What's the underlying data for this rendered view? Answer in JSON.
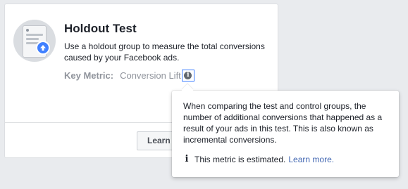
{
  "card": {
    "title": "Holdout Test",
    "description": "Use a holdout group to measure the total conversions caused by your Facebook ads.",
    "key_metric_label": "Key Metric:",
    "key_metric_value": "Conversion Lift",
    "learn_button": "Learn More",
    "thumbnail_icon": "phone-upload-icon",
    "info_icon": "info-icon"
  },
  "tooltip": {
    "body": "When comparing the test and control groups, the number of additional conversions that happened as a result of your ads in this test. This is also known as incremental conversions.",
    "note_icon": "info-i-icon",
    "note_text": "This metric is estimated.",
    "note_link": "Learn more."
  },
  "colors": {
    "page_background": "#e9ebee",
    "link": "#4267b2",
    "accent": "#4080ff",
    "muted_text": "#90949c"
  }
}
